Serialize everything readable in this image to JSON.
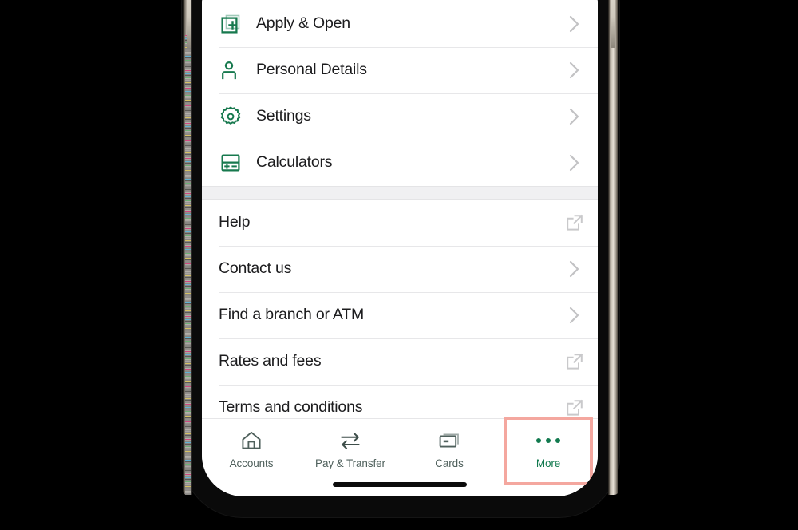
{
  "app": {
    "screen_name": "More",
    "accent_green": "#17794e",
    "tab_active_color": "#127a4f",
    "tab_inactive_color": "#4f605c",
    "highlight_color": "#f4a79f",
    "row_text_color": "#1c1c1e",
    "divider_color": "#e7e7e9",
    "group_gap_color": "#f0f0f2"
  },
  "menu": {
    "primary_group": [
      {
        "label": "Apply & Open",
        "icon": "plus-square-icon",
        "trailing": "chevron-right-icon"
      },
      {
        "label": "Personal Details",
        "icon": "person-icon",
        "trailing": "chevron-right-icon"
      },
      {
        "label": "Settings",
        "icon": "gear-icon",
        "trailing": "chevron-right-icon"
      },
      {
        "label": "Calculators",
        "icon": "calculator-icon",
        "trailing": "chevron-right-icon"
      }
    ],
    "secondary_group": [
      {
        "label": "Help",
        "trailing": "external-link-icon"
      },
      {
        "label": "Contact us",
        "trailing": "chevron-right-icon"
      },
      {
        "label": "Find a branch or ATM",
        "trailing": "chevron-right-icon"
      },
      {
        "label": "Rates and fees",
        "trailing": "external-link-icon"
      },
      {
        "label": "Terms and conditions",
        "trailing": "external-link-icon"
      }
    ]
  },
  "tabbar": {
    "tabs": [
      {
        "label": "Accounts",
        "icon": "home-icon",
        "active": false
      },
      {
        "label": "Pay & Transfer",
        "icon": "transfer-arrows-icon",
        "active": false
      },
      {
        "label": "Cards",
        "icon": "card-icon",
        "active": false
      },
      {
        "label": "More",
        "icon": "three-dots-icon",
        "active": true
      }
    ]
  }
}
